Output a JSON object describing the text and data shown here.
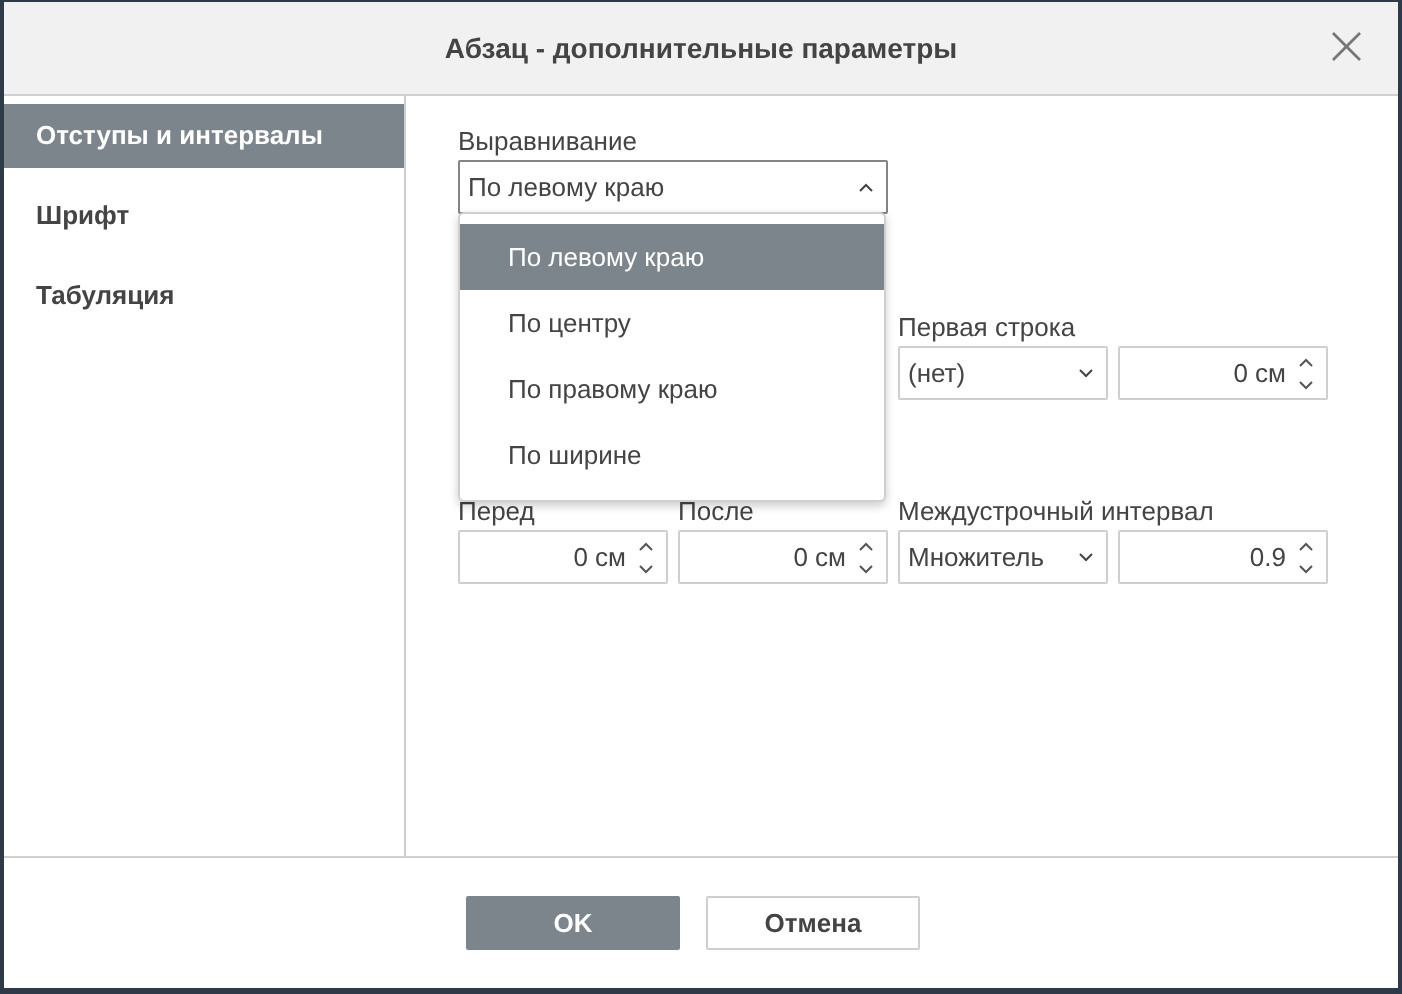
{
  "window": {
    "title": "Абзац - дополнительные параметры",
    "close": "×"
  },
  "sidebar": {
    "items": [
      {
        "label": "Отступы и интервалы",
        "selected": true
      },
      {
        "label": "Шрифт",
        "selected": false
      },
      {
        "label": "Табуляция",
        "selected": false
      }
    ]
  },
  "alignment": {
    "label": "Выравнивание",
    "value": "По левому краю",
    "expanded": true,
    "options": [
      {
        "label": "По левому краю",
        "selected": true
      },
      {
        "label": "По центру",
        "selected": false
      },
      {
        "label": "По правому краю",
        "selected": false
      },
      {
        "label": "По ширине",
        "selected": false
      }
    ]
  },
  "first_line": {
    "label": "Первая строка",
    "type": {
      "kind": "select",
      "value": "(нет)"
    },
    "size": {
      "kind": "spinner",
      "value": "0 см"
    }
  },
  "spacing": [
    {
      "label": "Перед",
      "field": {
        "kind": "spinner",
        "value": "0 см"
      }
    },
    {
      "label": "После",
      "field": {
        "kind": "spinner",
        "value": "0 см"
      }
    },
    {
      "label": "Междустрочный интервал",
      "field": {
        "kind": "select",
        "value": "Множитель"
      }
    },
    {
      "field": {
        "kind": "spinner",
        "value": "0.9"
      }
    }
  ],
  "buttons": [
    {
      "label": "OK",
      "kind": "primary"
    },
    {
      "label": "Отмена",
      "kind": "secondary"
    }
  ]
}
